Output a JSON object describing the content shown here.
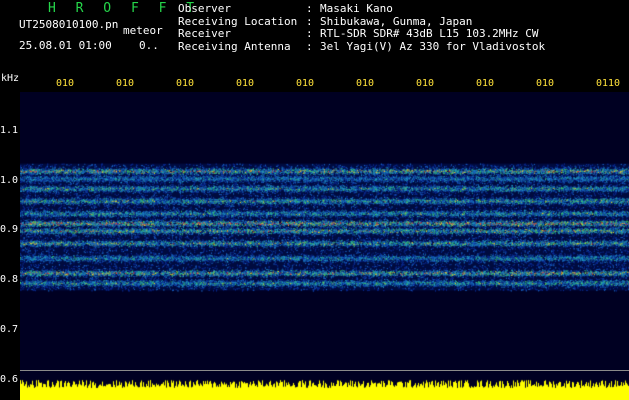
{
  "header": {
    "app_name": "H R O F F T",
    "file_name": "UT2508010100.pn",
    "meteor_label": "meteor",
    "datetime": "25.08.01 01:00",
    "counter": "0.."
  },
  "info": [
    {
      "label": "Observer",
      "sep": ":",
      "value": "Masaki Kano"
    },
    {
      "label": "Receiving Location",
      "sep": ":",
      "value": "Shibukawa, Gunma, Japan"
    },
    {
      "label": "Receiver",
      "sep": ":",
      "value": "RTL-SDR SDR# 43dB L15 103.2MHz CW"
    },
    {
      "label": "Receiving Antenna",
      "sep": ":",
      "value": "3el Yagi(V) Az 330 for Vladivostok"
    }
  ],
  "axis": {
    "unit": "kHz",
    "y_ticks": [
      "1.1",
      "1.0",
      "0.9",
      "0.8",
      "0.7",
      "0.6"
    ],
    "time_ticks": [
      "010",
      "010",
      "010",
      "010",
      "010",
      "010",
      "010",
      "010",
      "010",
      "0110"
    ]
  },
  "colors": {
    "background": "#000000",
    "plot_background": "#000033",
    "title_green": "#25d64a",
    "tick_yellow": "#ffe23a",
    "audio_yellow": "#ffff00"
  },
  "spectrogram": {
    "bands_khz": [
      1.02,
      1.005,
      0.985,
      0.96,
      0.935,
      0.915,
      0.9,
      0.875,
      0.845,
      0.815,
      0.795
    ],
    "band_strength": [
      0.9,
      0.5,
      0.7,
      0.75,
      0.7,
      1.0,
      0.85,
      0.8,
      0.6,
      0.9,
      0.7
    ],
    "noise_range_khz": [
      0.78,
      1.035
    ]
  }
}
